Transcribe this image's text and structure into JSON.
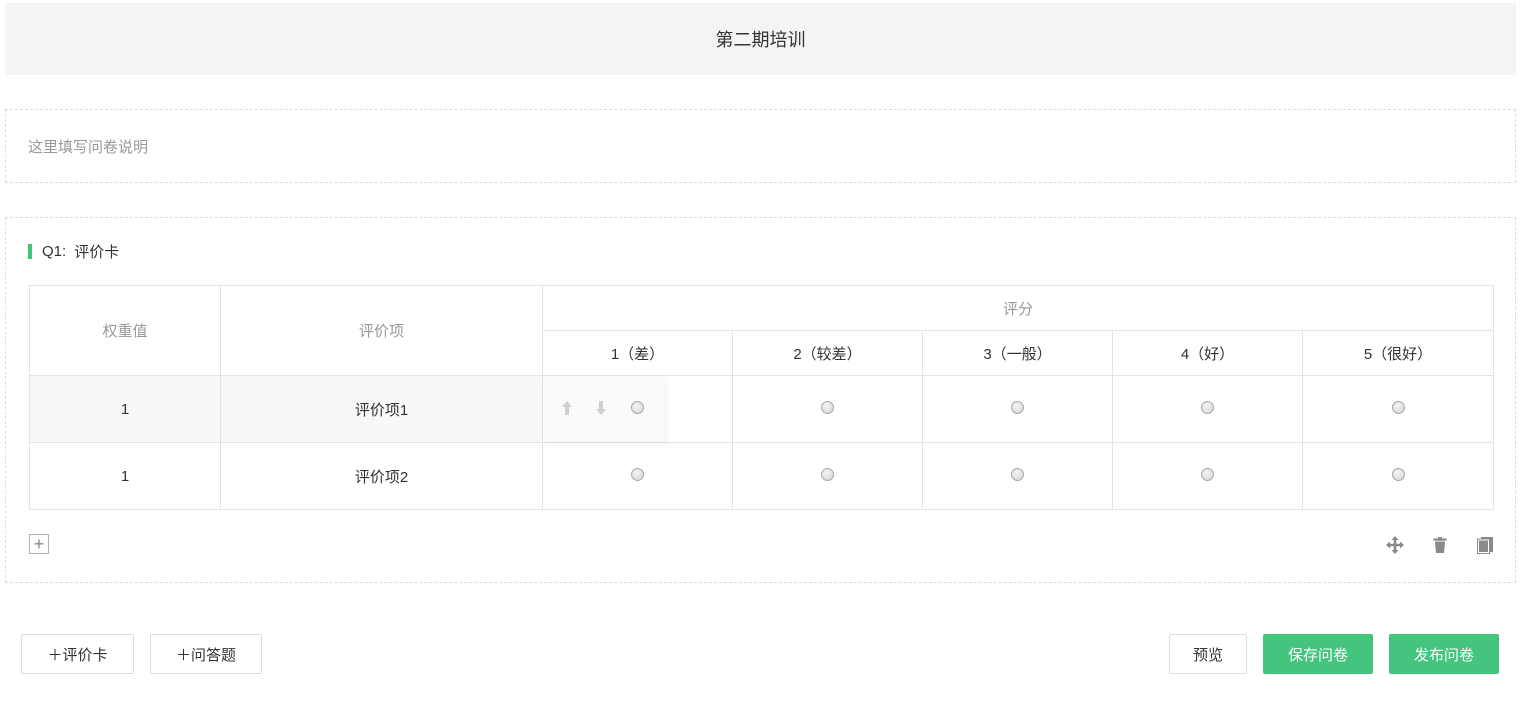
{
  "survey": {
    "title": "第二期培训",
    "description_placeholder": "这里填写问卷说明"
  },
  "question": {
    "label": "Q1:",
    "title": "评价卡",
    "accent_color": "#3ec679",
    "headers": {
      "weight": "权重值",
      "item": "评价项",
      "score": "评分"
    },
    "score_options": [
      "1（差）",
      "2（较差）",
      "3（一般）",
      "4（好）",
      "5（很好）"
    ],
    "rows": [
      {
        "weight": "1",
        "item": "评价项1"
      },
      {
        "weight": "1",
        "item": "评价项2"
      }
    ],
    "icons": [
      "move-up-icon",
      "move-down-icon",
      "add-row-icon",
      "drag-move-icon",
      "delete-icon",
      "copy-icon"
    ]
  },
  "footer": {
    "add_rating_card": "＋评价卡",
    "add_qa": "＋问答题",
    "preview": "预览",
    "save": "保存问卷",
    "publish": "发布问卷"
  },
  "colors": {
    "primary_green": "#43c57e",
    "title_bg": "#f4f4f4"
  }
}
